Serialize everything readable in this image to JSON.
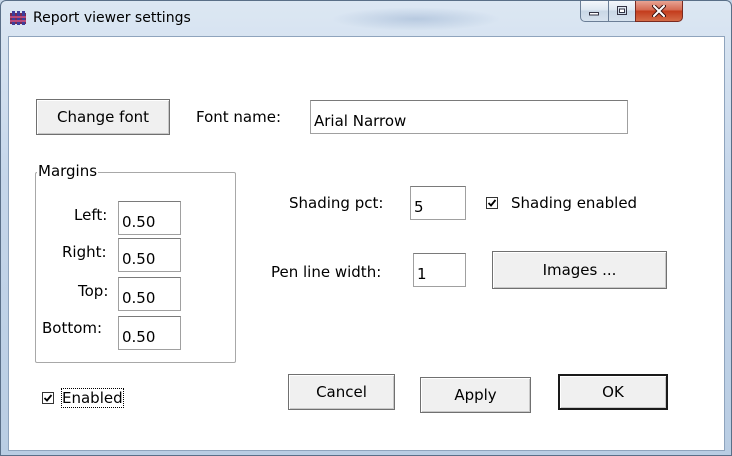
{
  "window": {
    "title": "Report viewer settings",
    "controls": {
      "minimize": "minimize",
      "maximize": "maximize",
      "close": "close"
    }
  },
  "font": {
    "change_font_label": "Change font",
    "name_label": "Font name:",
    "name_value": "Arial Narrow"
  },
  "margins": {
    "group_title": "Margins",
    "left_label": "Left:",
    "left_value": "0.50",
    "right_label": "Right:",
    "right_value": "0.50",
    "top_label": "Top:",
    "top_value": "0.50",
    "bottom_label": "Bottom:",
    "bottom_value": "0.50"
  },
  "shading": {
    "pct_label": "Shading pct:",
    "pct_value": "5",
    "enabled_label": "Shading enabled",
    "enabled_checked": true
  },
  "pen": {
    "label": "Pen line width:",
    "value": "1"
  },
  "images_button_label": "Images ...",
  "enabled": {
    "label": "Enabled",
    "checked": true
  },
  "buttons": {
    "cancel": "Cancel",
    "apply": "Apply",
    "ok": "OK"
  },
  "colors": {
    "title_bg": "#c6d6e8",
    "close_red": "#c33b1c",
    "client_bg": "#ffffff"
  }
}
